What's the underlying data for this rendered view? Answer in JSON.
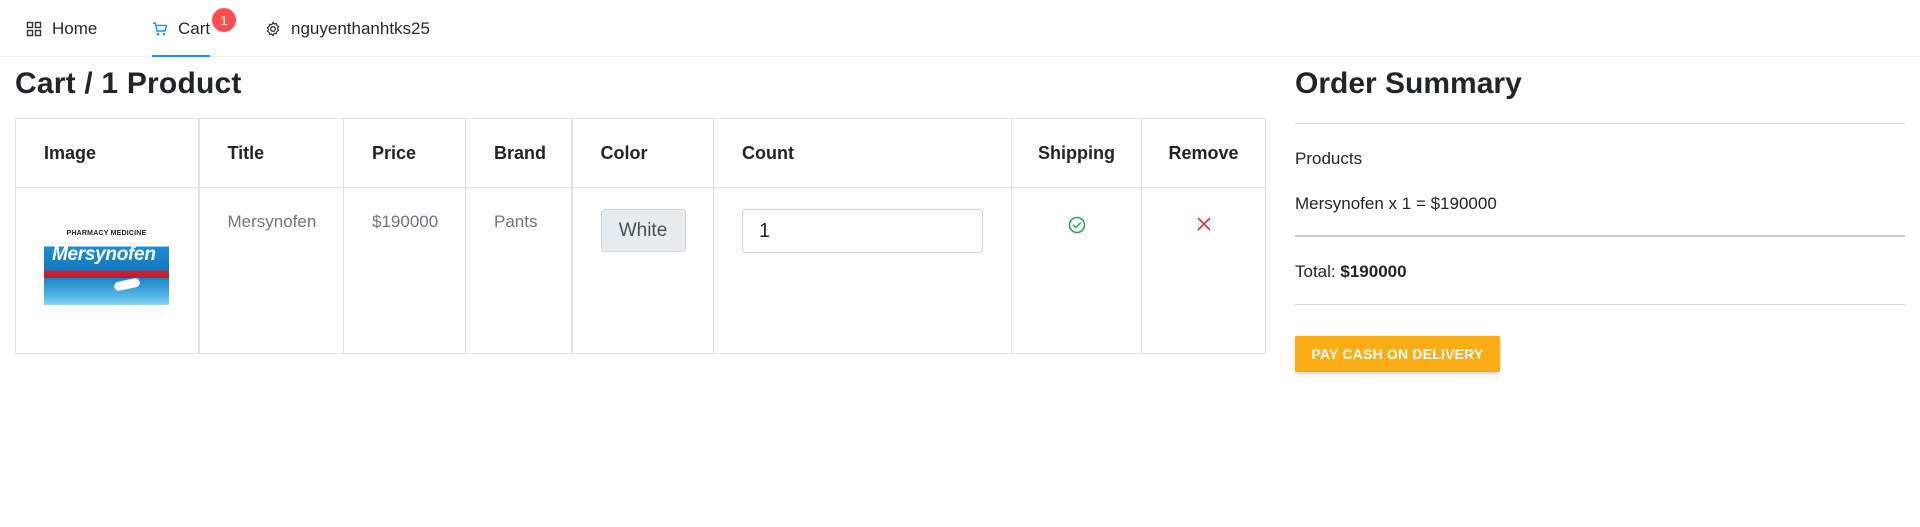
{
  "nav": {
    "home_label": "Home",
    "cart_label": "Cart",
    "cart_badge": "1",
    "user_label": "nguyenthanhtks25",
    "accent_color": "#1890ff",
    "badge_color": "#ff4d4f"
  },
  "cart": {
    "heading": "Cart / 1 Product",
    "columns": [
      "Image",
      "Title",
      "Price",
      "Brand",
      "Color",
      "Count",
      "Shipping",
      "Remove"
    ],
    "rows": [
      {
        "image_alt_brand": "Mersynofen",
        "image_top_text": "PHARMACY MEDICINE",
        "title": "Mersynofen",
        "price": "$190000",
        "brand": "Pants",
        "color": "White",
        "count": "1",
        "shipping_icon": "check-circle-icon",
        "remove_icon": "close-icon"
      }
    ]
  },
  "summary": {
    "title": "Order Summary",
    "products_label": "Products",
    "line_items": [
      "Mersynofen x 1 = $190000"
    ],
    "total_label": "Total:",
    "total_value": "$190000",
    "pay_button_label": "PAY CASH ON DELIVERY",
    "pay_button_color": "#faad14"
  }
}
